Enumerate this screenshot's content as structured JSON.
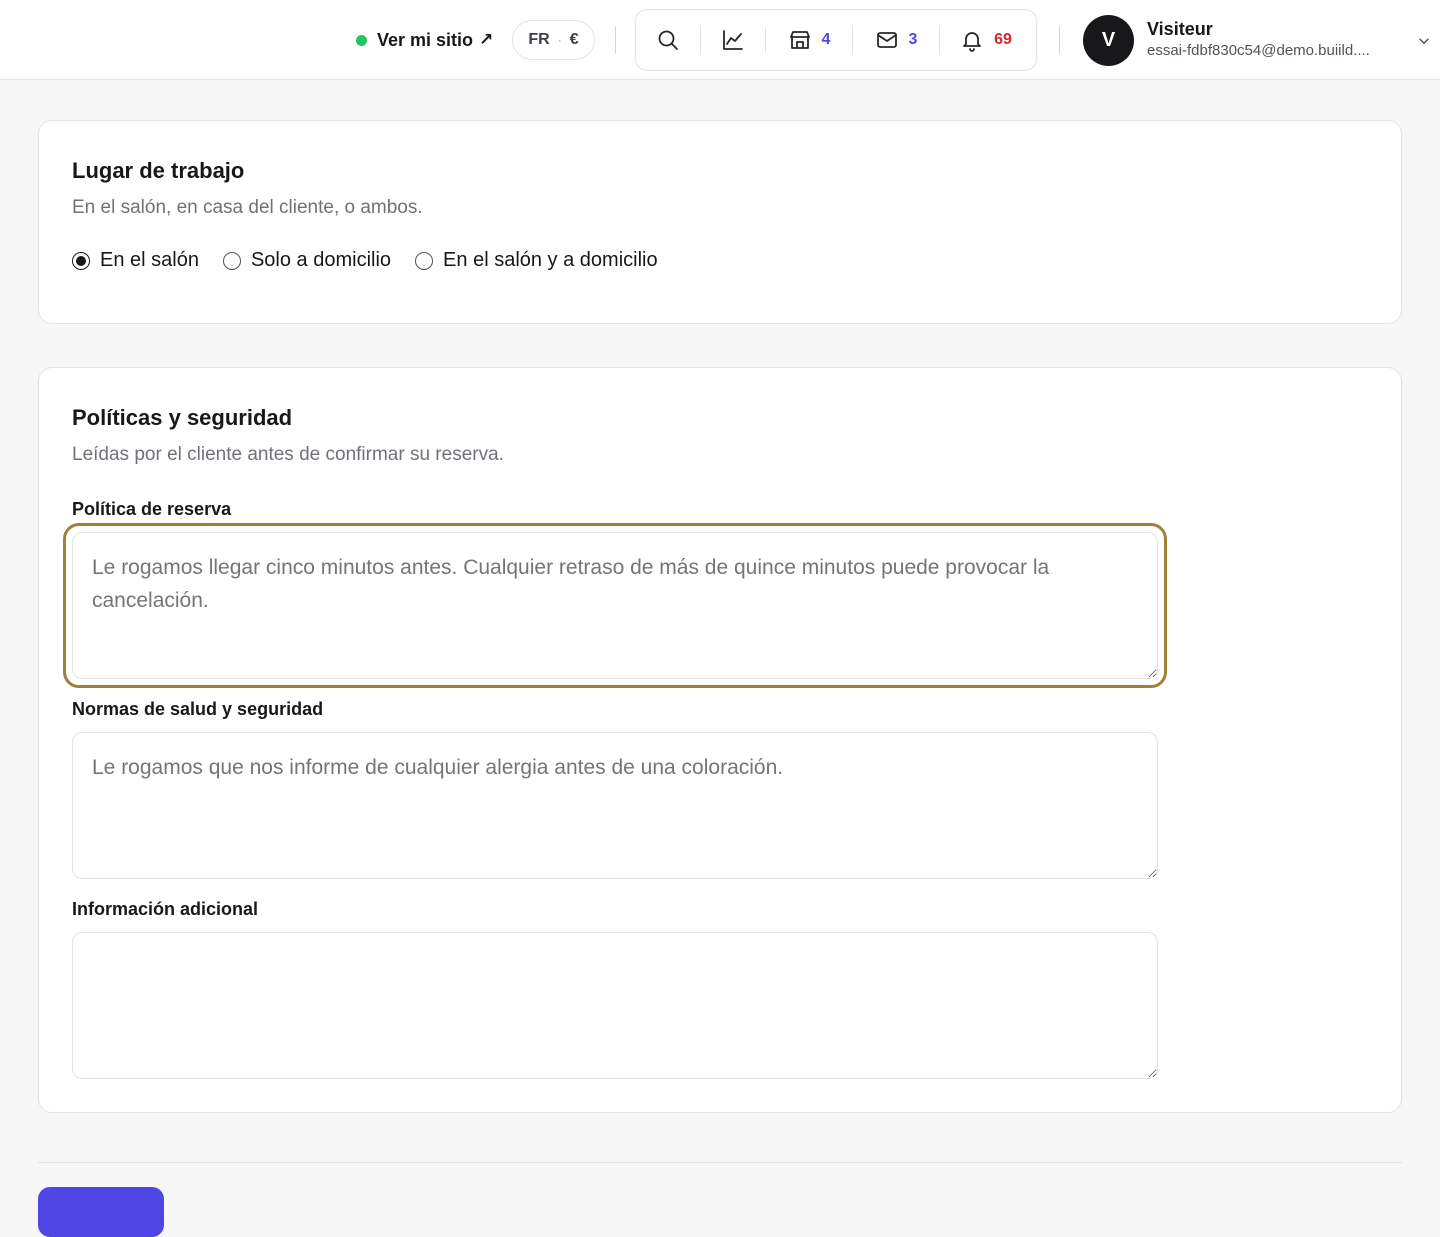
{
  "header": {
    "site_link_label": "Ver mi sitio",
    "site_link_arrow": "↗",
    "lang": "FR",
    "lang_sep": "·",
    "currency": "€",
    "shop_count": "4",
    "mail_count": "3",
    "notif_count": "69",
    "user": {
      "initial": "V",
      "name": "Visiteur",
      "email": "essai-fdbf830c54@demo.buiild...."
    }
  },
  "workplace": {
    "title": "Lugar de trabajo",
    "subtitle": "En el salón, en casa del cliente, o ambos.",
    "options": [
      {
        "label": "En el salón",
        "checked": true
      },
      {
        "label": "Solo a domicilio",
        "checked": false
      },
      {
        "label": "En el salón y a domicilio",
        "checked": false
      }
    ]
  },
  "policies": {
    "title": "Políticas y seguridad",
    "subtitle": "Leídas por el cliente antes de confirmar su reserva.",
    "booking_label": "Política de reserva",
    "booking_placeholder": "Le rogamos llegar cinco minutos antes. Cualquier retraso de más de quince minutos puede provocar la cancelación.",
    "health_label": "Normas de salud y seguridad",
    "health_placeholder": "Le rogamos que nos informe de cualquier alergia antes de una coloración.",
    "extra_label": "Información adicional",
    "extra_placeholder": ""
  },
  "colors": {
    "accent": "#4f46e5",
    "focus": "#a0813a",
    "status_online": "#22c55e",
    "notif_badge": "#dc2626"
  },
  "icons": [
    "search-icon",
    "chart-line-icon",
    "store-icon",
    "mail-icon",
    "bell-icon",
    "chevron-down-icon",
    "external-arrow-icon"
  ]
}
